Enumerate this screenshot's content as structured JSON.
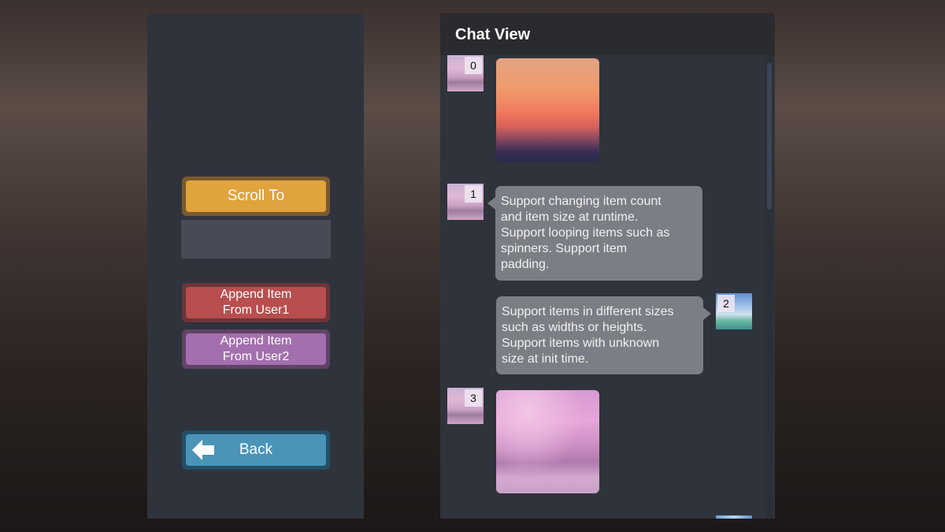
{
  "left_panel": {
    "scroll_to_label": "Scroll To",
    "scroll_input_value": "",
    "append_user1_label_line1": "Append Item",
    "append_user1_label_line2": "From User1",
    "append_user2_label_line1": "Append Item",
    "append_user2_label_line2": "From User2",
    "back_label": "Back",
    "back_icon": "arrow-left-icon"
  },
  "chat": {
    "title": "Chat View",
    "items": [
      {
        "index": "0",
        "kind": "image",
        "side": "left",
        "avatar": "pink-sky-avatar",
        "image": "sunset-photo"
      },
      {
        "index": "1",
        "kind": "text",
        "side": "left",
        "avatar": "pink-sky-avatar",
        "lines": [
          "Support changing item count",
          "and item size at runtime.",
          "Support looping items such as",
          "spinners. Support item",
          "padding."
        ]
      },
      {
        "index": "2",
        "kind": "text",
        "side": "right",
        "avatar": "sea-avatar",
        "lines": [
          "Support items in different sizes",
          "such as widths or heights.",
          "Support items with unknown",
          "size at init time."
        ]
      },
      {
        "index": "3",
        "kind": "image",
        "side": "left",
        "avatar": "pink-sky-avatar",
        "image": "pink-clouds-photo"
      }
    ]
  },
  "colors": {
    "scroll_to": "#e0a33d",
    "user1": "#b84e4e",
    "user2": "#a36fae",
    "back": "#4a94b8",
    "panel": "#2f333c",
    "bubble": "#7b7e85"
  }
}
